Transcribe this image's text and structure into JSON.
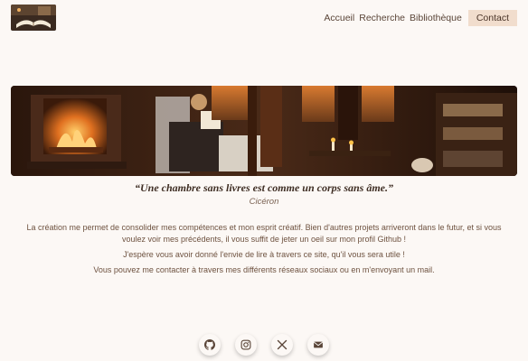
{
  "nav": {
    "items": [
      "Accueil",
      "Recherche",
      "Bibliothèque"
    ],
    "contact": "Contact"
  },
  "quote": {
    "text": "“Une chambre sans livres est comme un corps sans âme.”",
    "author": "Cicéron"
  },
  "paragraphs": [
    "La création me permet de consolider mes compétences et mon esprit créatif. Bien d'autres projets arriveront dans le futur, et si vous voulez voir mes précédents, il vous suffit de jeter un oeil sur mon profil Github !",
    "J'espère vous avoir donné l'envie de lire à travers ce site, qu'il vous sera utile !",
    "Vous pouvez me contacter à travers mes différents réseaux sociaux ou en m'envoyant un mail."
  ],
  "socials": [
    "github-icon",
    "instagram-icon",
    "x-icon",
    "mail-icon"
  ],
  "colors": {
    "background": "#fcf8f5",
    "text": "#6e5240",
    "contact_bg": "#f1ddcd"
  }
}
